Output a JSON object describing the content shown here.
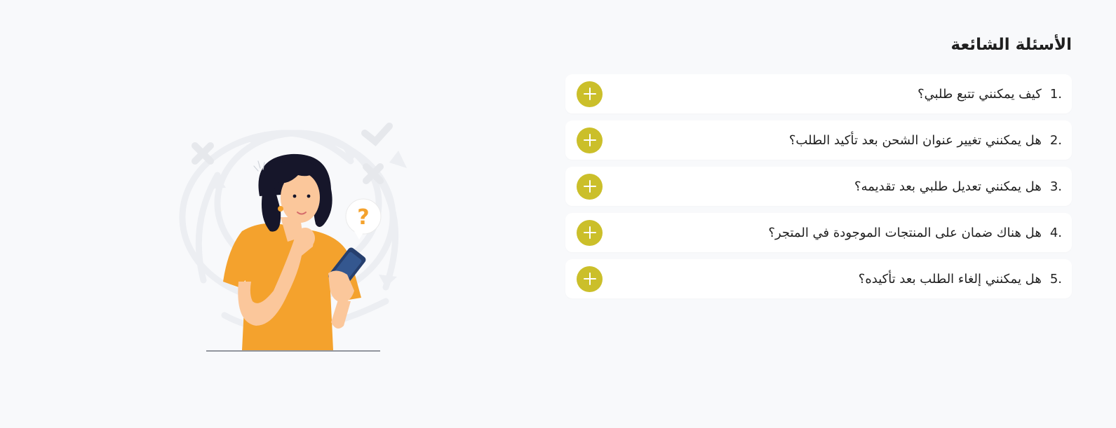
{
  "faq": {
    "title": "الأسئلة الشائعة",
    "items": [
      {
        "number": "1.",
        "question": "كيف يمكنني تتبع طلبي؟"
      },
      {
        "number": "2.",
        "question": "هل يمكنني تغيير عنوان الشحن بعد تأكيد الطلب؟"
      },
      {
        "number": "3.",
        "question": "هل يمكنني تعديل طلبي بعد تقديمه؟"
      },
      {
        "number": "4.",
        "question": "هل هناك ضمان على المنتجات الموجودة في المتجر؟"
      },
      {
        "number": "5.",
        "question": "هل يمكنني إلغاء الطلب بعد تأكيده؟"
      }
    ],
    "expand_icon": "plus-icon"
  },
  "illustration": {
    "subject": "woman-with-phone-thinking",
    "bubble_symbol": "?"
  },
  "colors": {
    "background": "#f8f9fb",
    "card": "#ffffff",
    "accent": "#cbbf2a",
    "shirt": "#f4a22d",
    "skin": "#fbc79b",
    "hair": "#16162a",
    "phone": "#263f6e",
    "decor": "#eceef2"
  }
}
